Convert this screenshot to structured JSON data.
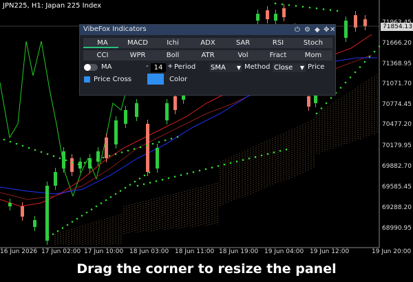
{
  "chart_title": "JPN225, H1:  Japan 225 Index",
  "current_price": "71854.13",
  "price_labels": [
    "71963.45",
    "71666.20",
    "71368.95",
    "71071.70",
    "70774.45",
    "70477.20",
    "70179.95",
    "69882.70",
    "69585.45",
    "69288.20",
    "68990.95"
  ],
  "time_labels": [
    "16 Jun 2026",
    "17 Jun 02:00",
    "17 Jun 10:00",
    "18 Jun 03:00",
    "18 Jun 11:00",
    "18 Jun 19:00",
    "19 Jun 04:00",
    "19 Jun 12:00",
    "19 Jun 20:00"
  ],
  "colors": {
    "bull": "#2ecc40",
    "bear": "#f07b6a",
    "ma_line": "#e02020",
    "blue_line": "#2233ff",
    "lime_line": "#22cc22",
    "cloud": "#d9a56a",
    "dots": "#33dd33",
    "accent": "#24c27a",
    "color_swatch": "#2e8ff0"
  },
  "panel": {
    "title": "VibeFox Indicators",
    "header_icons": [
      "power-icon",
      "settings-icon",
      "pin-icon",
      "move-icon",
      "close-icon"
    ],
    "tabs_row1": [
      "MA",
      "MACD",
      "Ichi",
      "ADX",
      "SAR",
      "RSI",
      "Stoch"
    ],
    "tabs_row2": [
      "CCI",
      "WPR",
      "Boll",
      "ATR",
      "Vol",
      "Fract",
      "Mom"
    ],
    "active_tab": "MA",
    "ma_label": "MA",
    "period_minus": "-",
    "period_value": "14",
    "period_plus": "+",
    "period_label": "Period",
    "method_value": "SMA",
    "method_label": "Method",
    "price_value": "Close",
    "price_label": "Price",
    "price_cross_label": "Price Cross",
    "color_label": "Color"
  },
  "caption": "Drag the corner to resize the panel"
}
